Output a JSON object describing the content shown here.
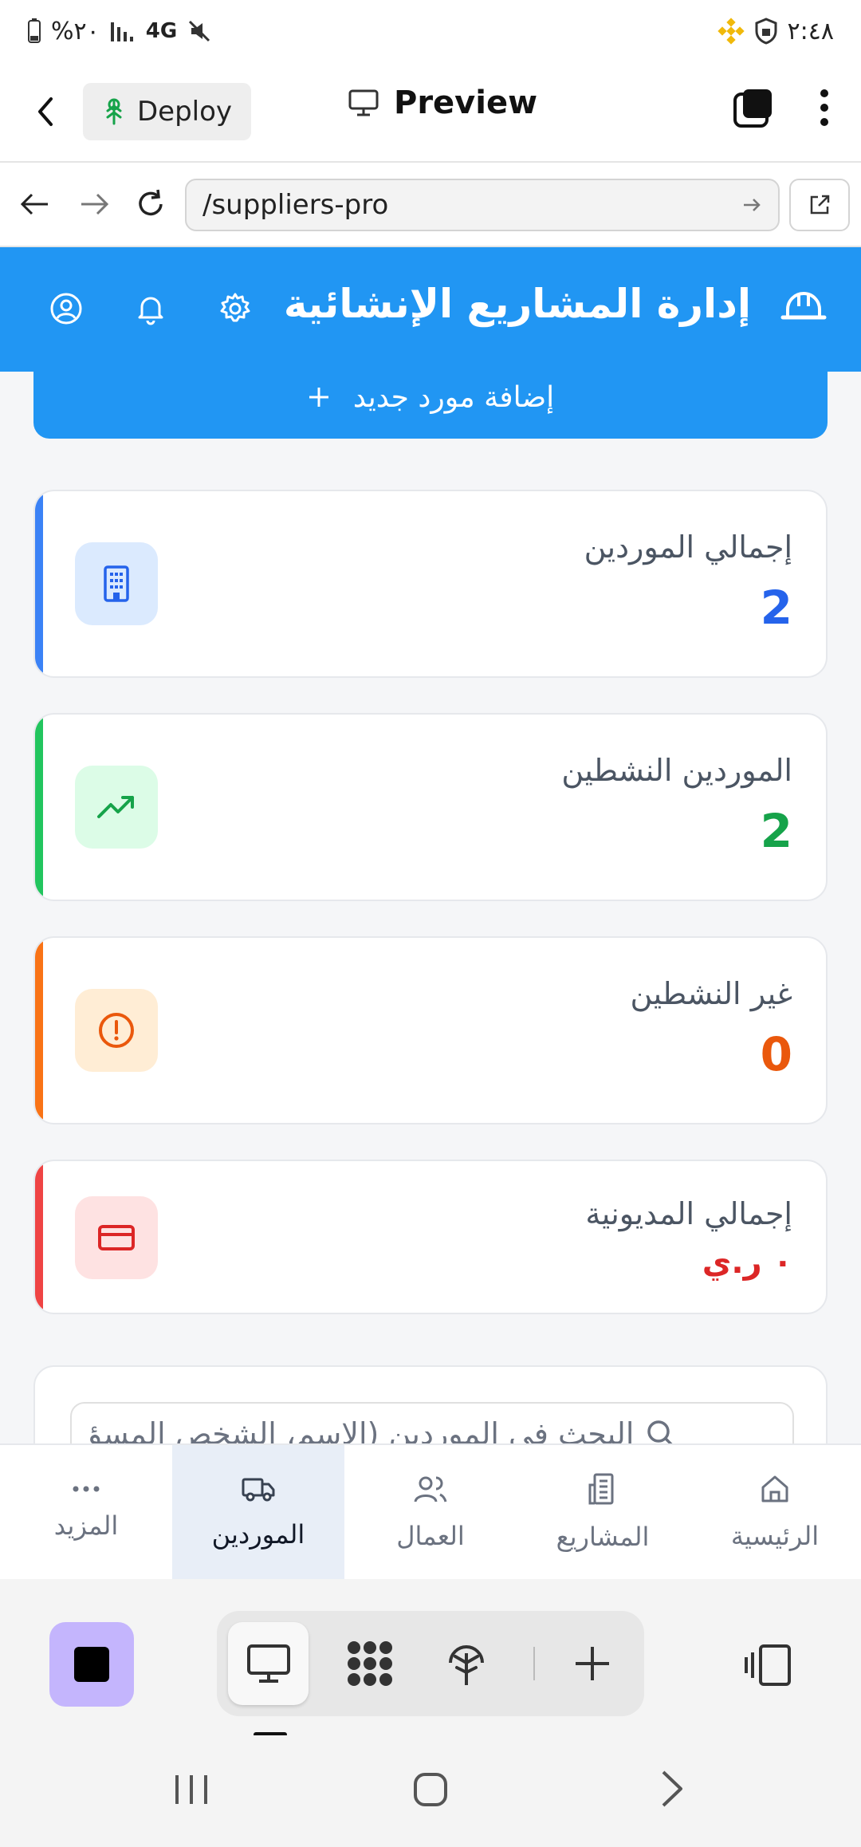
{
  "status_bar": {
    "time": "٢:٤٨",
    "battery": "%٢٠",
    "network": "4G"
  },
  "browser": {
    "deploy_label": "Deploy",
    "preview_label": "Preview",
    "url": "/suppliers-pro"
  },
  "app": {
    "title": "إدارة المشاريع الإنشائية",
    "add_supplier_label": "إضافة مورد جديد"
  },
  "stats": [
    {
      "label": "إجمالي الموردين",
      "value": "2",
      "color": "#2563eb",
      "accent": "#3b82f6",
      "icon_bg": "#dbeafe",
      "icon": "building-icon"
    },
    {
      "label": "الموردين النشطين",
      "value": "2",
      "color": "#16a34a",
      "accent": "#22c55e",
      "icon_bg": "#dcfce7",
      "icon": "trending-up-icon"
    },
    {
      "label": "غير النشطين",
      "value": "0",
      "color": "#ea580c",
      "accent": "#f97316",
      "icon_bg": "#ffedd5",
      "icon": "alert-circle-icon"
    },
    {
      "label": "إجمالي المديونية",
      "value": "٠ ر.ي",
      "color": "#dc2626",
      "accent": "#ef4444",
      "icon_bg": "#fee2e2",
      "icon": "credit-card-icon"
    }
  ],
  "search": {
    "placeholder": "البحث في الموردين (الاسم، الشخص المسؤ"
  },
  "bottom_nav": [
    {
      "label": "المزيد",
      "icon": "more-icon",
      "active": false
    },
    {
      "label": "الموردين",
      "icon": "truck-icon",
      "active": true
    },
    {
      "label": "العمال",
      "icon": "users-icon",
      "active": false
    },
    {
      "label": "المشاريع",
      "icon": "building-icon",
      "active": false
    },
    {
      "label": "الرئيسية",
      "icon": "home-icon",
      "active": false
    }
  ],
  "colors": {
    "primary": "#2196f3",
    "dock_accent": "#c4b5fd"
  }
}
